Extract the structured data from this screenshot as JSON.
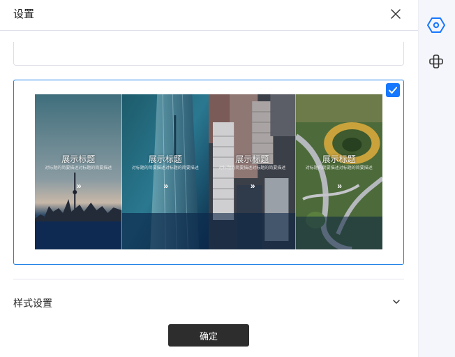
{
  "dialog": {
    "title": "设置",
    "close_icon": "close-icon"
  },
  "preview": {
    "selected": true,
    "panes": [
      {
        "title": "展示标题",
        "subtitle": "对标题的简要描述对标题的简要描述",
        "chevron": "»",
        "scene": "city-skyline-sunset"
      },
      {
        "title": "展示标题",
        "subtitle": "对标题的简要描述对标题的简要描述",
        "chevron": "»",
        "scene": "glass-skyscraper"
      },
      {
        "title": "展示标题",
        "subtitle": "对标题的简要描述对标题的简要描述",
        "chevron": "»",
        "scene": "aerial-downtown"
      },
      {
        "title": "展示标题",
        "subtitle": "对标题的简要描述对标题的简要描述",
        "chevron": "»",
        "scene": "aerial-green-roads"
      }
    ]
  },
  "style_settings": {
    "label": "样式设置",
    "icon": "chevron-down-icon"
  },
  "confirm": {
    "label": "确定"
  },
  "rail": {
    "items": [
      {
        "icon": "hexagon-settings-icon",
        "active": true
      },
      {
        "icon": "component-icon",
        "active": false
      }
    ]
  },
  "colors": {
    "accent": "#1677ff",
    "confirm_bg": "#2d2d2d",
    "rail_bg": "#f4f6fb"
  }
}
